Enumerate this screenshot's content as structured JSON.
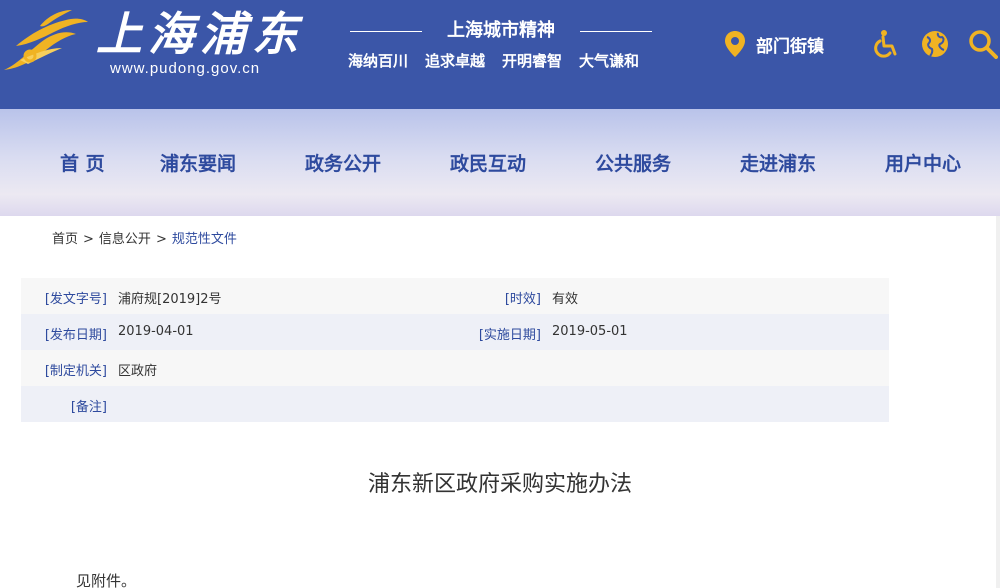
{
  "header": {
    "site_title": "上海浦东",
    "site_url": "www.pudong.gov.cn",
    "spirit_title": "上海城市精神",
    "spirit_words": [
      "海纳百川",
      "追求卓越",
      "开明睿智",
      "大气谦和"
    ],
    "dept_link": "部门街镇",
    "icons": [
      "location-pin-icon",
      "accessibility-icon",
      "globe-icon",
      "search-icon"
    ],
    "brand_color": "#3b56a8",
    "logo_color": "#f0b323"
  },
  "nav": {
    "items": [
      "首 页",
      "浦东要闻",
      "政务公开",
      "政民互动",
      "公共服务",
      "走进浦东",
      "用户中心"
    ]
  },
  "breadcrumb": {
    "items": [
      "首页",
      "信息公开",
      "规范性文件"
    ],
    "separator": ">"
  },
  "meta": {
    "doc_number_label": "[发文字号]",
    "doc_number": "浦府规[2019]2号",
    "validity_label": "[时效]",
    "validity": "有效",
    "publish_date_label": "[发布日期]",
    "publish_date": "2019-04-01",
    "effective_date_label": "[实施日期]",
    "effective_date": "2019-05-01",
    "issuer_label": "[制定机关]",
    "issuer": "区政府",
    "note_label": "[备注]",
    "note": ""
  },
  "document": {
    "title": "浦东新区政府采购实施办法",
    "body": "见附件。"
  }
}
